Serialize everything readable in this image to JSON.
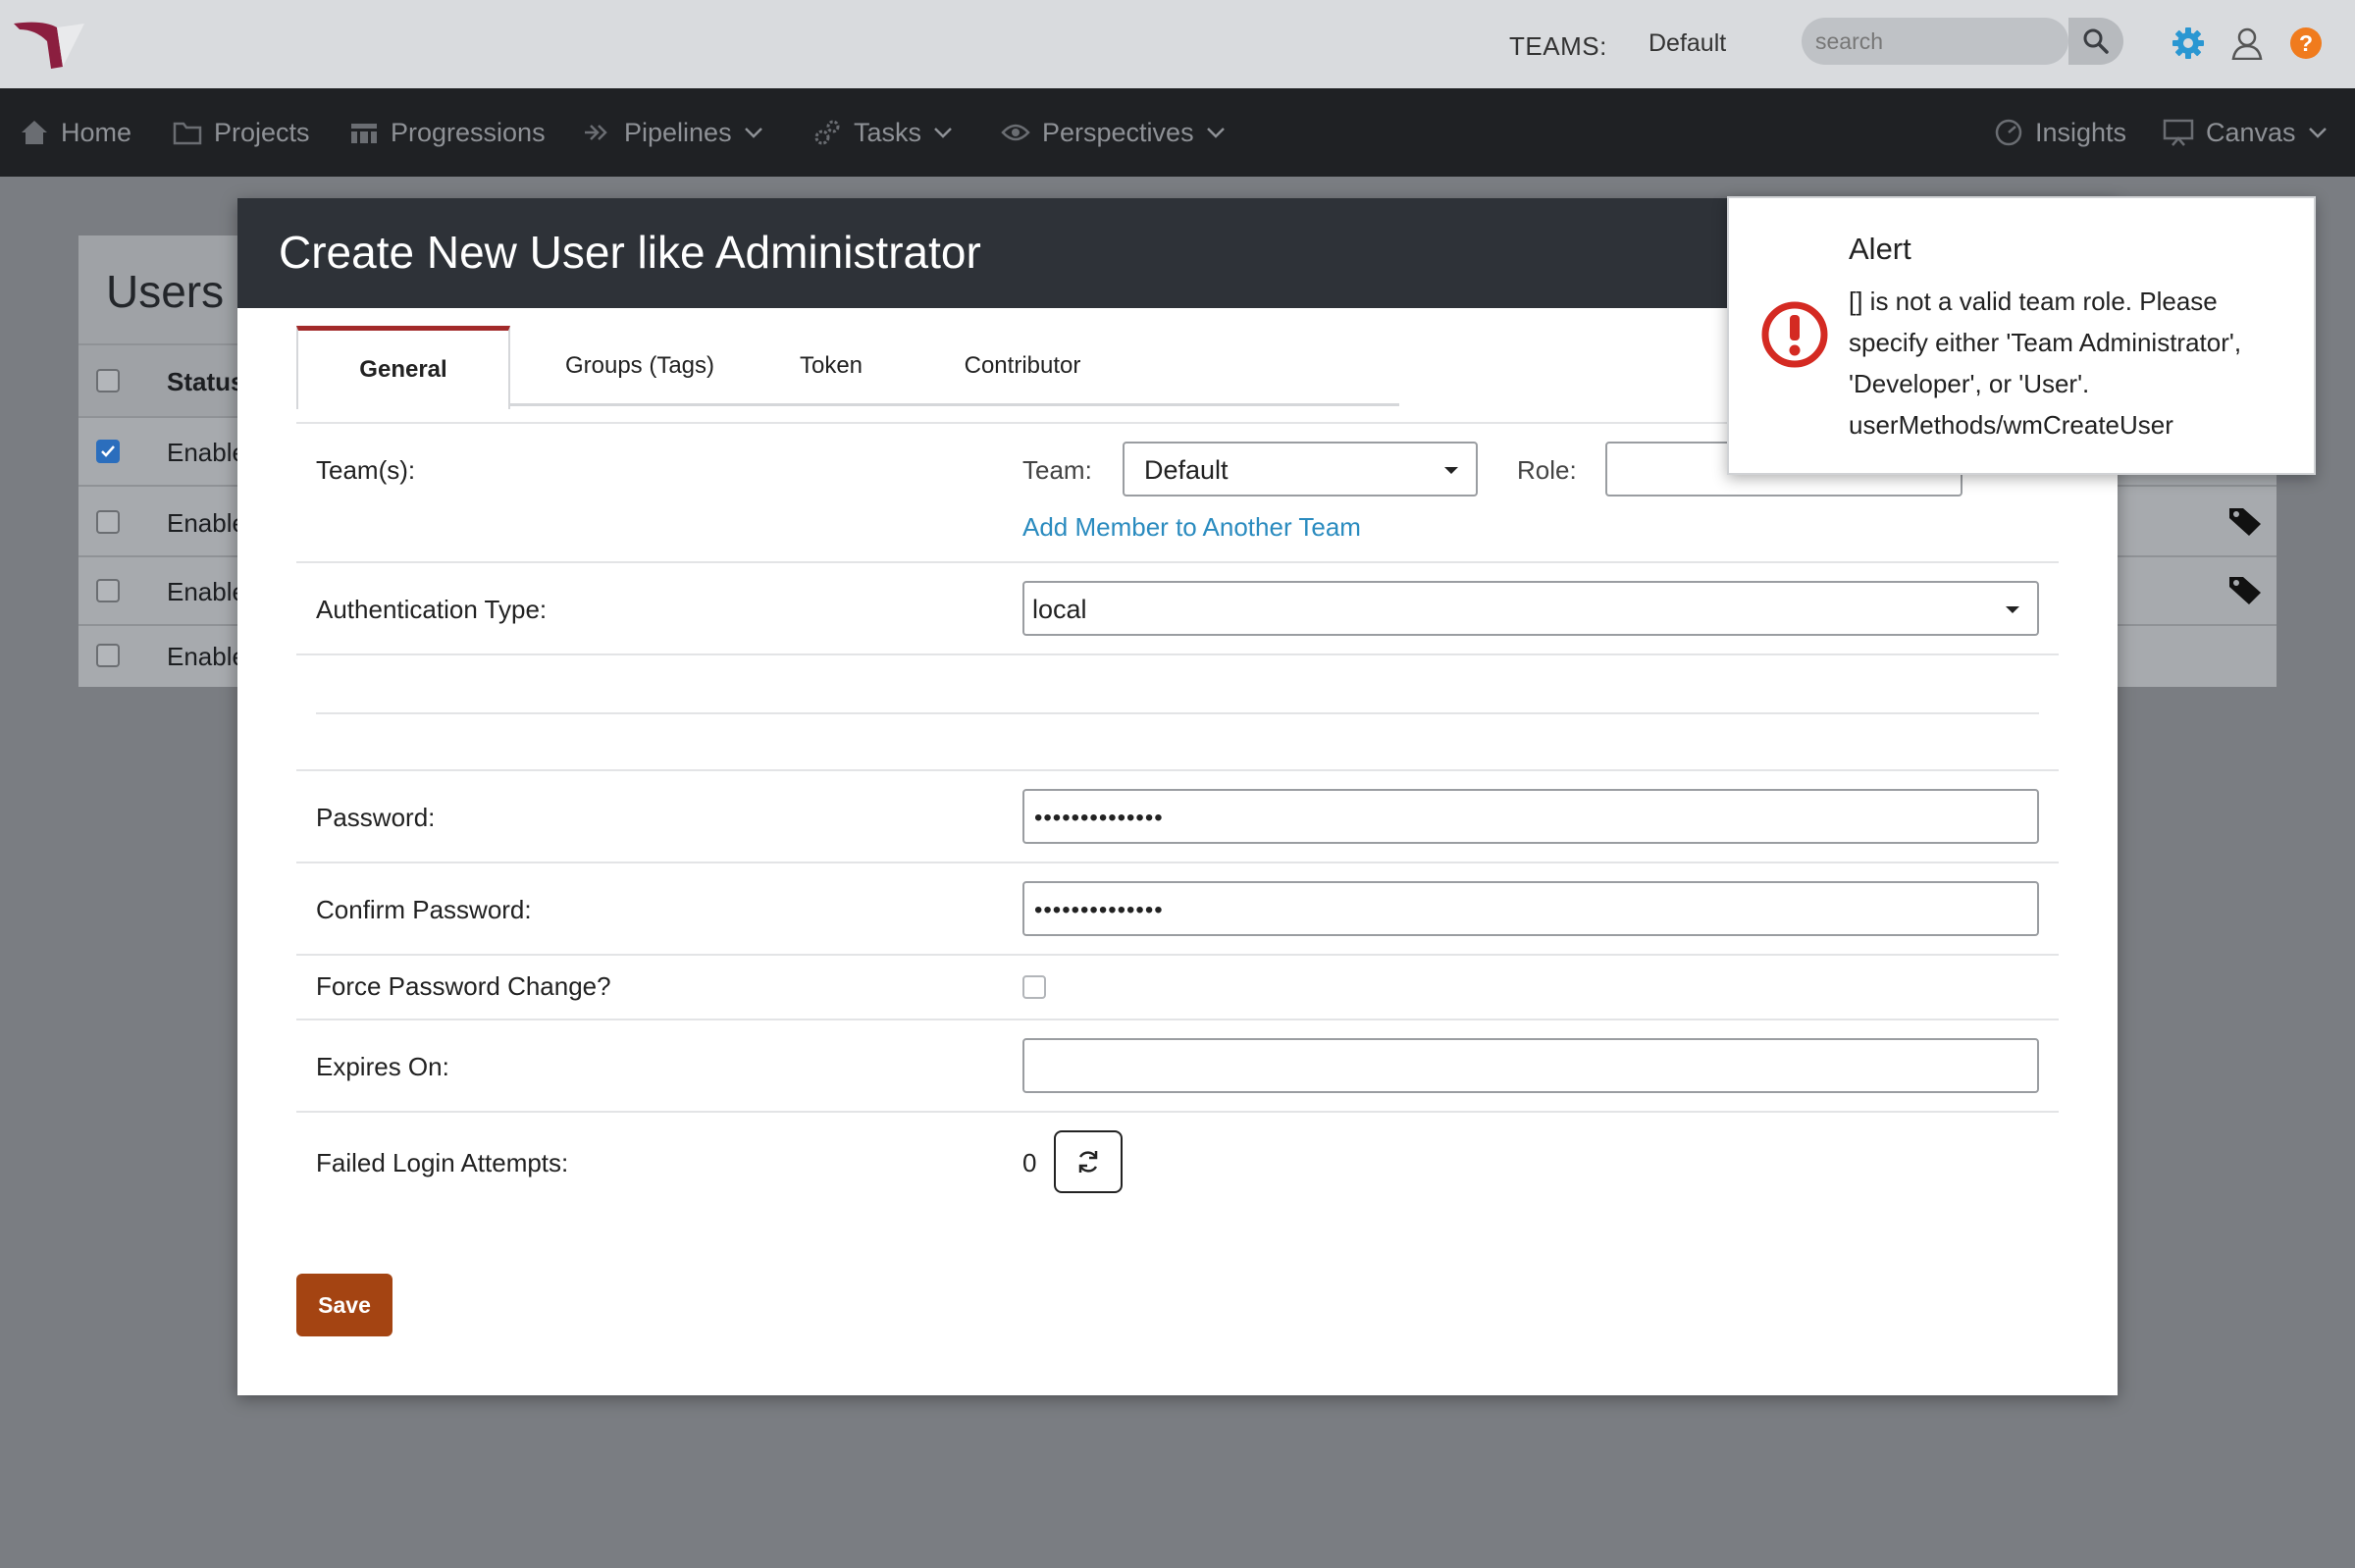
{
  "header": {
    "teams_label": "TEAMS:",
    "team_selected": "Default",
    "search_placeholder": "search"
  },
  "nav": {
    "items": [
      {
        "label": "Home",
        "icon": "home-icon"
      },
      {
        "label": "Projects",
        "icon": "folder-icon"
      },
      {
        "label": "Progressions",
        "icon": "progressions-icon"
      },
      {
        "label": "Pipelines",
        "icon": "pipelines-icon"
      },
      {
        "label": "Tasks",
        "icon": "gears-icon"
      },
      {
        "label": "Perspectives",
        "icon": "eye-icon"
      },
      {
        "label": "Insights",
        "icon": "gauge-icon"
      },
      {
        "label": "Canvas",
        "icon": "easel-icon"
      }
    ]
  },
  "users_panel": {
    "title": "Users",
    "header_col": "Status",
    "rows": [
      {
        "status": "Enabled",
        "checked": true
      },
      {
        "status": "Enabled",
        "checked": false
      },
      {
        "status": "Enabled",
        "checked": false
      },
      {
        "status": "Enabled",
        "checked": false
      }
    ]
  },
  "modal": {
    "title": "Create New User like Administrator",
    "tabs": [
      "General",
      "Groups (Tags)",
      "Token",
      "Contributor"
    ],
    "active_tab": "General",
    "teams_label": "Team(s):",
    "team_label": "Team:",
    "team_value": "Default",
    "role_label": "Role:",
    "role_value": "",
    "add_member_link": "Add Member to Another Team",
    "auth_label": "Authentication Type:",
    "auth_value": "local",
    "password_label": "Password:",
    "password_value": "••••••••••••••",
    "confirm_label": "Confirm Password:",
    "confirm_value": "••••••••••••••",
    "force_label": "Force Password Change?",
    "force_checked": false,
    "expires_label": "Expires On:",
    "expires_value": "",
    "failed_label": "Failed Login Attempts:",
    "failed_value": "0",
    "save_label": "Save"
  },
  "alert": {
    "title": "Alert",
    "message": "[] is not a valid team role. Please specify either 'Team Administrator', 'Developer', or 'User'. userMethods/wmCreateUser"
  },
  "colors": {
    "accent_blue": "#2a8bbf",
    "save_button": "#a44412",
    "alert_red": "#d42a22",
    "tab_active_border": "#a22a2a",
    "help_orange": "#f07b1d"
  }
}
